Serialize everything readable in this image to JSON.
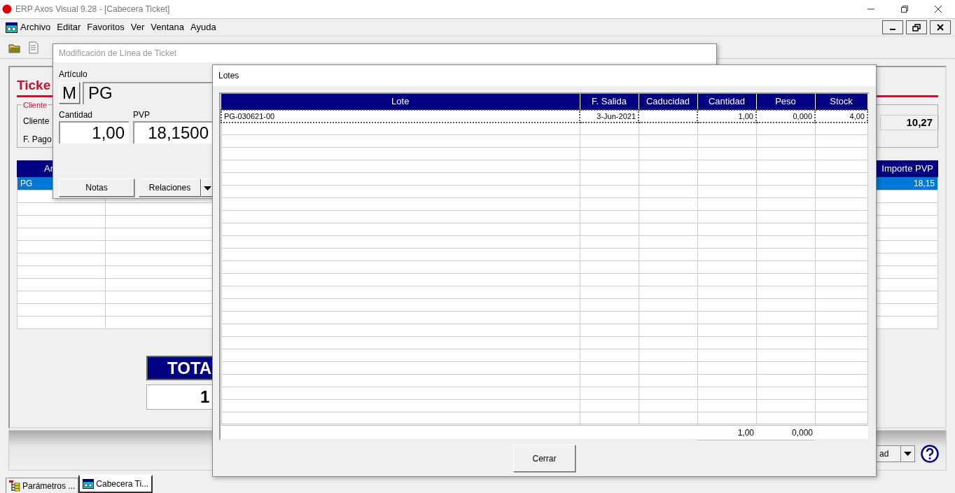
{
  "app_window": {
    "title": "ERP Axos Visual 9.28 - [Cabecera Ticket]"
  },
  "menu": [
    "Archivo",
    "Editar",
    "Favoritos",
    "Ver",
    "Ventana",
    "Ayuda"
  ],
  "ticket_form": {
    "heading": "Ticke",
    "cliente_group": {
      "legend": "Cliente",
      "labels": [
        "Cliente",
        "F. Pago"
      ]
    },
    "summary_value": "10,27",
    "lines_table": {
      "columns": [
        "Ar",
        "Importe PVP"
      ],
      "rows": [
        {
          "cells": [
            "PG",
            "18,15"
          ],
          "selected": true
        }
      ]
    },
    "total": {
      "label": "TOTA",
      "value": "1"
    }
  },
  "bottom_bar": {
    "dropdown_value": "ad"
  },
  "taskbar": [
    {
      "label": "Parámetros ...",
      "selected": false
    },
    {
      "label": "Cabecera Ti...",
      "selected": true
    }
  ],
  "line_dialog": {
    "title": "Modificación de Línea de Ticket",
    "articulo_label": "Artículo",
    "mode_button": "M",
    "articulo_value": "PG",
    "fields": [
      {
        "label": "Cantidad",
        "value": "1,00"
      },
      {
        "label": "PVP",
        "value": "18,1500"
      }
    ],
    "buttons": [
      {
        "label": "Notas",
        "kind": "plain"
      },
      {
        "label": "Relaciones",
        "kind": "split"
      }
    ]
  },
  "lotes_dialog": {
    "title": "Lotes",
    "columns": [
      "Lote",
      "F. Salida",
      "Caducidad",
      "Cantidad",
      "Peso",
      "Stock"
    ],
    "rows": [
      {
        "cells": [
          "PG-030621-00",
          "3-Jun-2021",
          "",
          "1,00",
          "0,000",
          "4,00"
        ],
        "selected": true
      }
    ],
    "totals": {
      "cantidad": "1,00",
      "peso": "0,000"
    },
    "close_button": "Cerrar"
  }
}
